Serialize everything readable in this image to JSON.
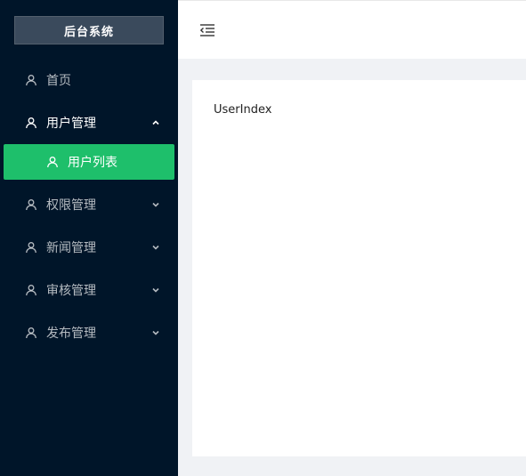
{
  "sidebar": {
    "logo": "后台系统",
    "menu": [
      {
        "label": "首页",
        "icon": "user-icon",
        "has_children": false
      },
      {
        "label": "用户管理",
        "icon": "user-icon",
        "has_children": true,
        "expanded": true,
        "children": [
          {
            "label": "用户列表",
            "icon": "user-icon",
            "active": true
          }
        ]
      },
      {
        "label": "权限管理",
        "icon": "user-icon",
        "has_children": true,
        "expanded": false
      },
      {
        "label": "新闻管理",
        "icon": "user-icon",
        "has_children": true,
        "expanded": false
      },
      {
        "label": "审核管理",
        "icon": "user-icon",
        "has_children": true,
        "expanded": false
      },
      {
        "label": "发布管理",
        "icon": "user-icon",
        "has_children": true,
        "expanded": false
      }
    ]
  },
  "header": {
    "fold_icon": "menu-fold-icon"
  },
  "content": {
    "text": "UserIndex"
  },
  "colors": {
    "sidebar_bg": "#001529",
    "active_bg": "#1ebf6b",
    "page_bg": "#f0f2f5"
  }
}
